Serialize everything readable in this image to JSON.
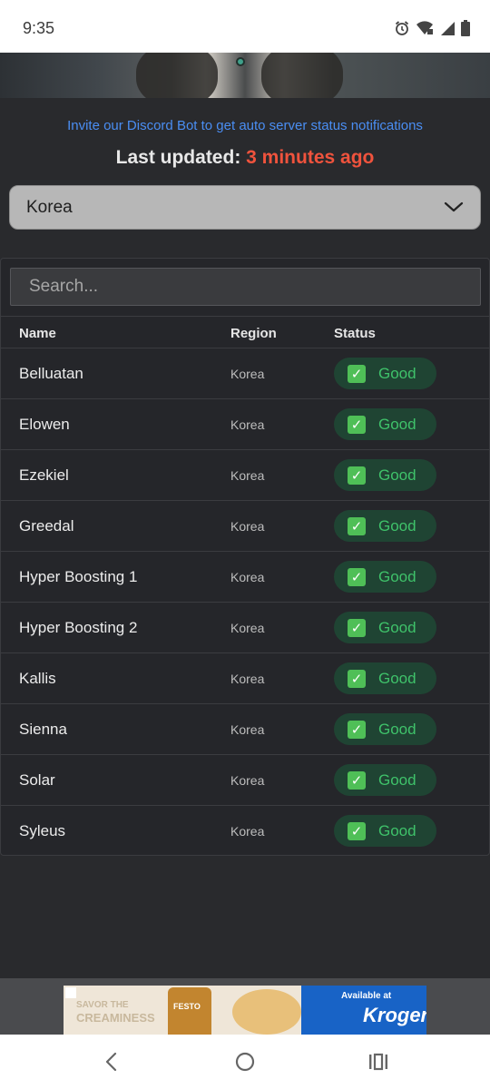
{
  "status_bar": {
    "time": "9:35",
    "icons": [
      "alarm-icon",
      "wifi-icon",
      "signal-icon",
      "battery-icon"
    ]
  },
  "banner": {
    "discord_link": "Invite our Discord Bot to get auto server status notifications",
    "updated_label": "Last updated:",
    "updated_value": "3 minutes ago"
  },
  "region_select": {
    "selected": "Korea"
  },
  "search": {
    "placeholder": "Search..."
  },
  "table": {
    "columns": [
      "Name",
      "Region",
      "Status"
    ],
    "rows": [
      {
        "name": "Belluatan",
        "region": "Korea",
        "status": "Good"
      },
      {
        "name": "Elowen",
        "region": "Korea",
        "status": "Good"
      },
      {
        "name": "Ezekiel",
        "region": "Korea",
        "status": "Good"
      },
      {
        "name": "Greedal",
        "region": "Korea",
        "status": "Good"
      },
      {
        "name": "Hyper Boosting 1",
        "region": "Korea",
        "status": "Good"
      },
      {
        "name": "Hyper Boosting 2",
        "region": "Korea",
        "status": "Good"
      },
      {
        "name": "Kallis",
        "region": "Korea",
        "status": "Good"
      },
      {
        "name": "Sienna",
        "region": "Korea",
        "status": "Good"
      },
      {
        "name": "Solar",
        "region": "Korea",
        "status": "Good"
      },
      {
        "name": "Syleus",
        "region": "Korea",
        "status": "Good"
      }
    ]
  },
  "ad": {
    "line1": "SAVOR THE",
    "line2": "CREAMINESS",
    "jar_label": "FESTO",
    "available": "Available at",
    "brand": "Kroger"
  },
  "colors": {
    "accent_link": "#4a8ef3",
    "updated_highlight": "#f0533d",
    "status_good": "#3fc26a",
    "background": "#292a2d"
  }
}
